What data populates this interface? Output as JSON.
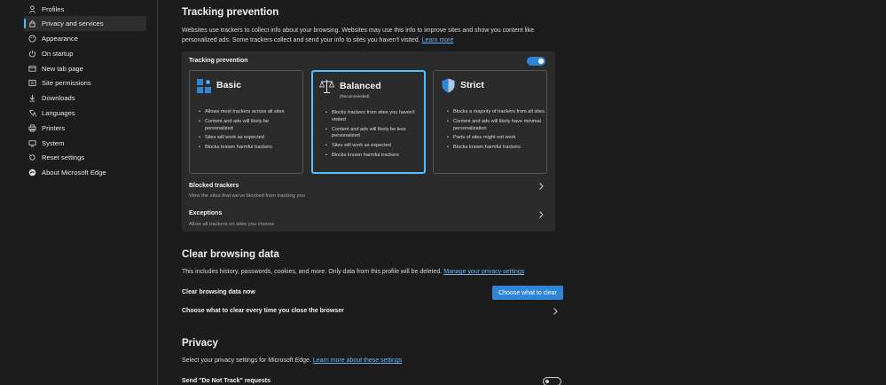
{
  "sidebar": {
    "items": [
      {
        "label": "Profiles",
        "icon": "person-icon"
      },
      {
        "label": "Privacy and services",
        "icon": "lock-icon"
      },
      {
        "label": "Appearance",
        "icon": "palette-icon"
      },
      {
        "label": "On startup",
        "icon": "power-icon"
      },
      {
        "label": "New tab page",
        "icon": "new-tab-icon"
      },
      {
        "label": "Site permissions",
        "icon": "site-permissions-icon"
      },
      {
        "label": "Downloads",
        "icon": "download-icon"
      },
      {
        "label": "Languages",
        "icon": "languages-icon"
      },
      {
        "label": "Printers",
        "icon": "printer-icon"
      },
      {
        "label": "System",
        "icon": "system-icon"
      },
      {
        "label": "Reset settings",
        "icon": "reset-icon"
      },
      {
        "label": "About Microsoft Edge",
        "icon": "edge-logo-icon"
      }
    ],
    "active_index": 1
  },
  "tracking": {
    "heading": "Tracking prevention",
    "description": "Websites use trackers to collect info about your browsing. Websites may use this info to improve sites and show you content like personalized ads. Some trackers collect and send your info to sites you haven't visited.",
    "learn_more": "Learn more",
    "panel_title": "Tracking prevention",
    "enabled": true,
    "cards": [
      {
        "title": "Basic",
        "subtitle": "",
        "icon": "basic-blocks-icon",
        "bullets": [
          "Allows most trackers across all sites",
          "Content and ads will likely be personalized",
          "Sites will work as expected",
          "Blocks known harmful trackers"
        ]
      },
      {
        "title": "Balanced",
        "subtitle": "(Recommended)",
        "icon": "balance-scale-icon",
        "selected": true,
        "bullets": [
          "Blocks trackers from sites you haven't visited",
          "Content and ads will likely be less personalized",
          "Sites will work as expected",
          "Blocks known harmful trackers"
        ]
      },
      {
        "title": "Strict",
        "subtitle": "",
        "icon": "shield-icon",
        "bullets": [
          "Blocks a majority of trackers from all sites",
          "Content and ads will likely have minimal personalization",
          "Parts of sites might not work",
          "Blocks known harmful trackers"
        ]
      }
    ],
    "blocked_title": "Blocked trackers",
    "blocked_sub": "View the sites that we've blocked from tracking you",
    "exceptions_title": "Exceptions",
    "exceptions_sub": "Allow all trackers on sites you choose"
  },
  "clear": {
    "heading": "Clear browsing data",
    "description": "This includes history, passwords, cookies, and more. Only data from this profile will be deleted.",
    "manage_link": "Manage your privacy settings",
    "now_label": "Clear browsing data now",
    "button_label": "Choose what to clear",
    "every_time_label": "Choose what to clear every time you close the browser"
  },
  "privacy": {
    "heading": "Privacy",
    "description": "Select your privacy settings for Microsoft Edge.",
    "learn_link": "Learn more about these settings",
    "dnt_label": "Send \"Do Not Track\" requests",
    "dnt_enabled": false
  },
  "colors": {
    "accent": "#4cc2ff",
    "button": "#2f86d7",
    "background": "#1c1c1c",
    "panel": "#2b2b2b"
  }
}
